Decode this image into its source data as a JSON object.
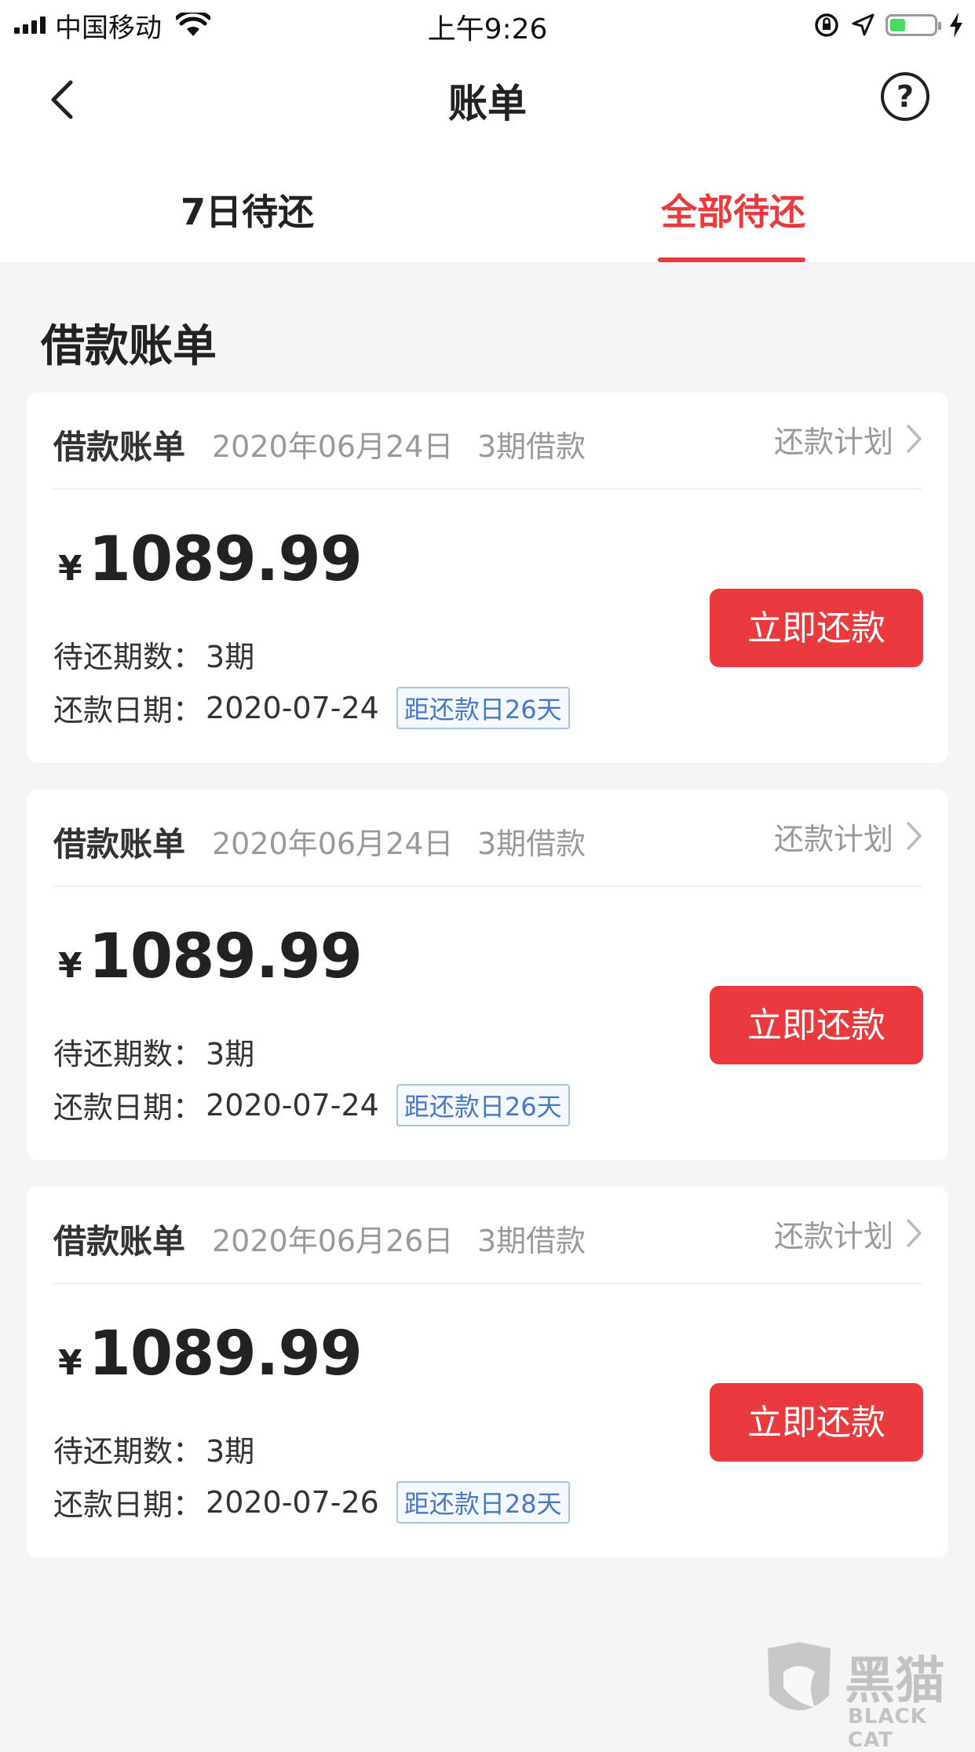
{
  "status_bar": {
    "carrier": "中国移动",
    "time": "上午9:26",
    "battery_level": 0.35
  },
  "nav": {
    "title": "账单",
    "help": "?"
  },
  "tabs": [
    {
      "label": "7日待还",
      "active": false
    },
    {
      "label": "全部待还",
      "active": true
    }
  ],
  "section_title": "借款账单",
  "bills": [
    {
      "title": "借款账单",
      "date": "2020年06月24日",
      "periods": "3期借款",
      "plan_label": "还款计划",
      "currency": "¥",
      "amount": "1089.99",
      "remaining_label": "待还期数：",
      "remaining_value": "3期",
      "due_label": "还款日期：",
      "due_date": "2020-07-24",
      "days_badge": "距还款日26天",
      "pay_button": "立即还款"
    },
    {
      "title": "借款账单",
      "date": "2020年06月24日",
      "periods": "3期借款",
      "plan_label": "还款计划",
      "currency": "¥",
      "amount": "1089.99",
      "remaining_label": "待还期数：",
      "remaining_value": "3期",
      "due_label": "还款日期：",
      "due_date": "2020-07-24",
      "days_badge": "距还款日26天",
      "pay_button": "立即还款"
    },
    {
      "title": "借款账单",
      "date": "2020年06月26日",
      "periods": "3期借款",
      "plan_label": "还款计划",
      "currency": "¥",
      "amount": "1089.99",
      "remaining_label": "待还期数：",
      "remaining_value": "3期",
      "due_label": "还款日期：",
      "due_date": "2020-07-26",
      "days_badge": "距还款日28天",
      "pay_button": "立即还款"
    }
  ],
  "watermark": {
    "cn": "黑猫",
    "en": "BLACK CAT"
  },
  "colors": {
    "accent": "#e93b3d",
    "badge_blue": "#4878c6",
    "background": "#f5f5f7"
  }
}
